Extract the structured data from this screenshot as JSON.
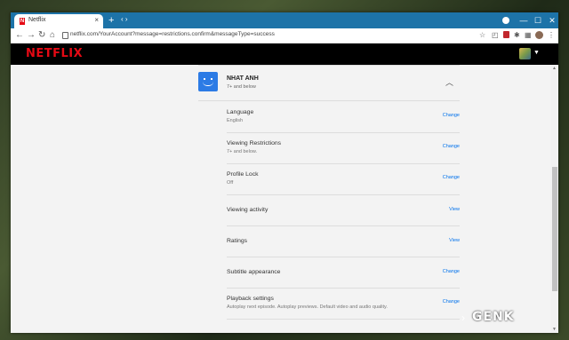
{
  "browser": {
    "tab_title": "Netflix",
    "tab_favicon": "N",
    "url": "netflix.com/YourAccount?message=restrictions.confirm&messageType=success",
    "new_tab": "+",
    "tab_search": "‹ ›",
    "window_controls": {
      "minimize": "—",
      "maximize": "☐",
      "close": "✕"
    }
  },
  "netflix": {
    "logo": "NETFLIX"
  },
  "profile": {
    "name": "NHAT ANH",
    "rating": "7+ and below"
  },
  "settings": [
    {
      "title": "Language",
      "subtitle": "English",
      "action": "Change"
    },
    {
      "title": "Viewing Restrictions",
      "subtitle": "7+ and below.",
      "action": "Change"
    },
    {
      "title": "Profile Lock",
      "subtitle": "Off",
      "action": "Change"
    },
    {
      "title": "Viewing activity",
      "subtitle": "",
      "action": "View"
    },
    {
      "title": "Ratings",
      "subtitle": "",
      "action": "View"
    },
    {
      "title": "Subtitle appearance",
      "subtitle": "",
      "action": "Change"
    },
    {
      "title": "Playback settings",
      "subtitle": "Autoplay next episode. Autoplay previews. Default video and audio quality.",
      "action": "Change"
    }
  ],
  "watermark": "GENK",
  "colors": {
    "netflix_red": "#e50914",
    "link_blue": "#0071eb",
    "profile_blue": "#2c7be5",
    "titlebar": "#1d73a8"
  },
  "icons": [
    "back-arrow-icon",
    "forward-arrow-icon",
    "reload-icon",
    "home-icon",
    "lock-icon",
    "star-icon",
    "extensions-icon",
    "menu-icon",
    "chevron-up-icon"
  ]
}
